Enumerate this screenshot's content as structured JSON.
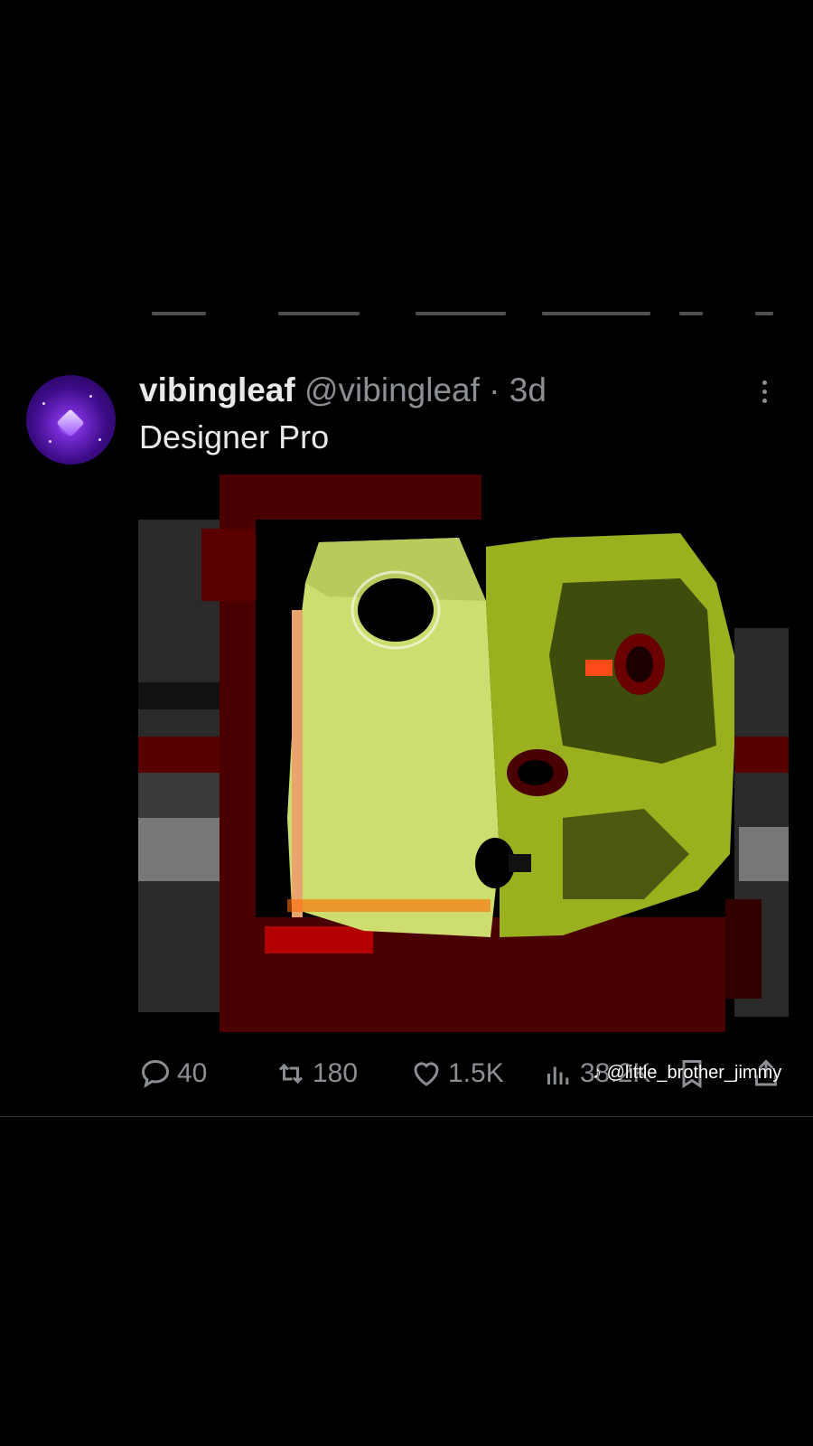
{
  "post": {
    "display_name": "vibingleaf",
    "handle": "@vibingleaf",
    "separator": "·",
    "time": "3d",
    "text": "Designer Pro",
    "media_icon": "frog-pixel-image"
  },
  "actions": {
    "replies": "40",
    "reposts": "180",
    "likes": "1.5K",
    "views": "38.2K"
  },
  "watermark": {
    "platform_icon": "tiktok-icon",
    "text": "@little_brother_jimmy"
  },
  "icons": [
    "reply-icon",
    "repost-icon",
    "like-icon",
    "views-icon",
    "bookmark-icon",
    "share-icon",
    "more-options-icon"
  ]
}
